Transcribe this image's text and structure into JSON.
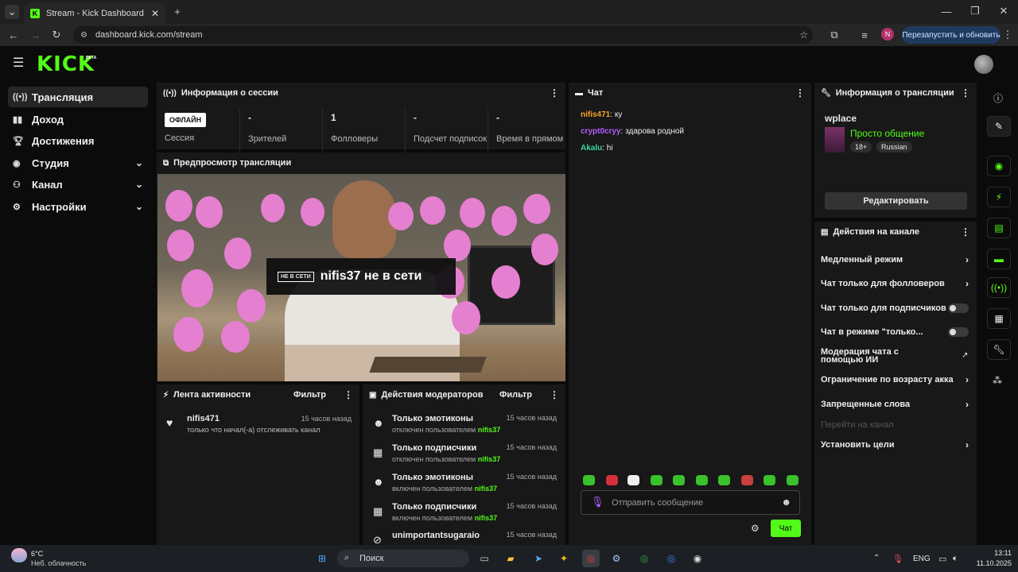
{
  "browser": {
    "tab_title": "Stream - Kick Dashboard",
    "url": "dashboard.kick.com/stream",
    "relaunch_label": "Перезапустить и обновить",
    "profile_initial": "N"
  },
  "brand": {
    "logo": "KICK",
    "badge": "BETA",
    "accent": "#53fc18"
  },
  "sidebar": {
    "items": [
      {
        "label": "Трансляция",
        "icon": "broadcast-icon",
        "active": true
      },
      {
        "label": "Доход",
        "icon": "chart-icon"
      },
      {
        "label": "Достижения",
        "icon": "trophy-icon"
      },
      {
        "label": "Студия",
        "icon": "studio-icon",
        "expandable": true
      },
      {
        "label": "Канал",
        "icon": "channel-icon",
        "expandable": true
      },
      {
        "label": "Настройки",
        "icon": "gear-icon",
        "expandable": true
      }
    ]
  },
  "session": {
    "title": "Информация о сессии",
    "status_badge": "ОФЛАЙН",
    "status_label": "Сессия",
    "stats": [
      {
        "value": "-",
        "label": "Зрителей"
      },
      {
        "value": "1",
        "label": "Фолловеры"
      },
      {
        "value": "-",
        "label": "Подсчет подписок"
      },
      {
        "value": "-",
        "label": "Время в прямом"
      }
    ]
  },
  "preview": {
    "title": "Предпросмотр трансляции",
    "offline_badge": "НЕ В СЕТИ",
    "offline_text": "nifis37 не в сети"
  },
  "activity": {
    "title": "Лента активности",
    "filter_label": "Фильтр",
    "items": [
      {
        "user": "nifis471",
        "time": "15 часов назад",
        "text": "только что начал(-а) отслеживать канал"
      }
    ]
  },
  "mod_actions": {
    "title": "Действия модераторов",
    "filter_label": "Фильтр",
    "items": [
      {
        "title": "Только эмотиконы",
        "time": "15 часов назад",
        "desc": "отключен пользователем",
        "by": "nifis37",
        "icon": "smile-icon"
      },
      {
        "title": "Только подписчики",
        "time": "15 часов назад",
        "desc": "отключен пользователем",
        "by": "nifis37",
        "icon": "gift-icon"
      },
      {
        "title": "Только эмотиконы",
        "time": "15 часов назад",
        "desc": "включен пользователем",
        "by": "nifis37",
        "icon": "smile-icon"
      },
      {
        "title": "Только подписчики",
        "time": "15 часов назад",
        "desc": "включен пользователем",
        "by": "nifis37",
        "icon": "gift-icon"
      },
      {
        "title": "unimportantsugaraio",
        "time": "15 часов назад",
        "desc": "",
        "by": "",
        "icon": "ban-icon"
      }
    ]
  },
  "chat": {
    "title": "Чат",
    "messages": [
      {
        "user": "nifis471",
        "color": "#f5a623",
        "text": "ку"
      },
      {
        "user": "crypt0cryy",
        "color": "#b45cff",
        "text": "здарова родной"
      },
      {
        "user": "Akalu",
        "color": "#3ad6a4",
        "text": "hi"
      }
    ],
    "input_placeholder": "Отправить сообщение",
    "send_label": "Чат"
  },
  "stream_info": {
    "title": "Информация о трансляции",
    "stream_title": "wplace",
    "category": "Просто общение",
    "tags": [
      "18+",
      "Russian"
    ],
    "edit_label": "Редактировать"
  },
  "channel_actions": {
    "title": "Действия на канале",
    "items": [
      {
        "label": "Медленный режим",
        "control": "arrow"
      },
      {
        "label": "Чат только для фолловеров",
        "control": "arrow"
      },
      {
        "label": "Чат только для подписчиков",
        "control": "toggle"
      },
      {
        "label": "Чат в режиме \"только...",
        "control": "toggle"
      },
      {
        "label": "Модерация чата с помощью ИИ",
        "control": "external"
      },
      {
        "label": "Ограничение по возрасту акка",
        "control": "arrow"
      },
      {
        "label": "Запрещенные слова",
        "control": "arrow"
      },
      {
        "label": "Перейти на канал",
        "control": "none",
        "disabled": true
      },
      {
        "label": "Установить цели",
        "control": "arrow"
      }
    ]
  },
  "taskbar": {
    "weather_temp": "6°C",
    "weather_desc": "Неб. облачность",
    "search_label": "Поиск",
    "lang": "ENG",
    "time": "13:11",
    "date": "11.10.2025"
  }
}
